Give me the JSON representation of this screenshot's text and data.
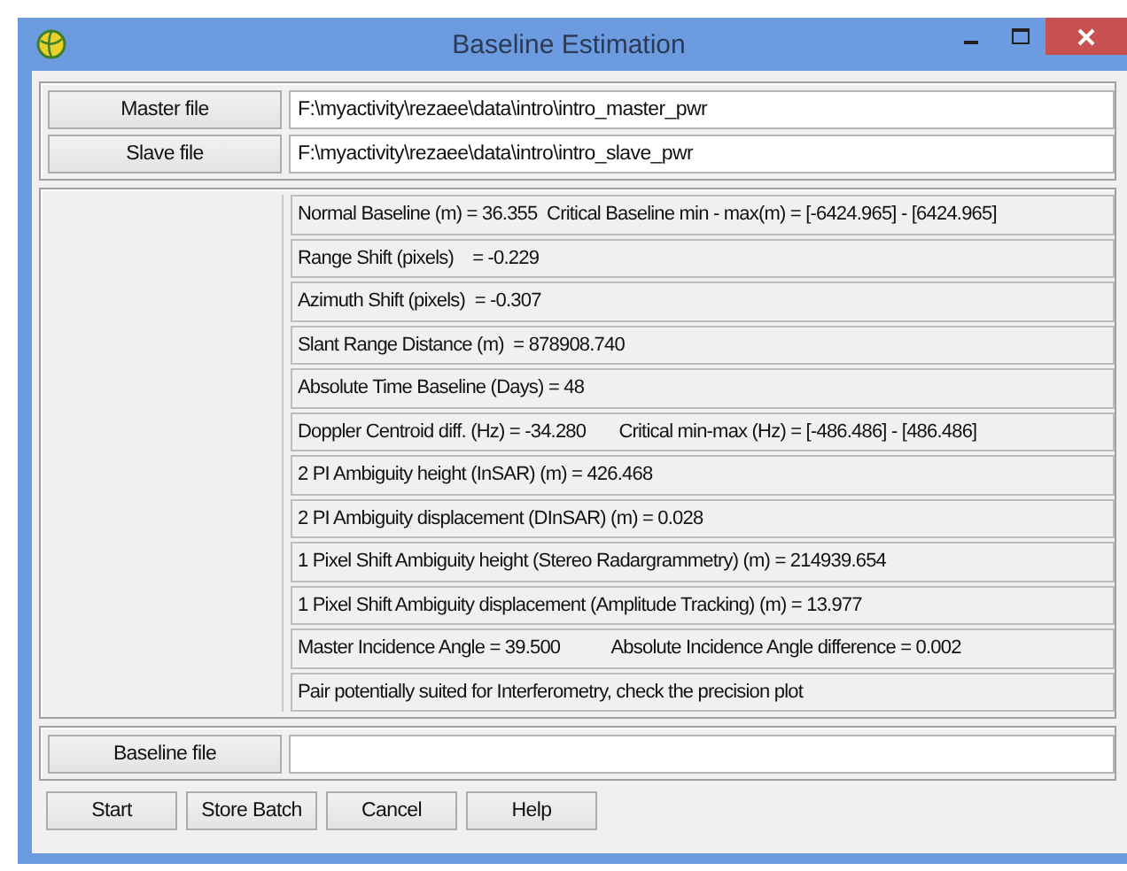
{
  "window": {
    "title": "Baseline Estimation"
  },
  "files": [
    {
      "button": "Master file",
      "value": "F:\\myactivity\\rezaee\\data\\intro\\intro_master_pwr"
    },
    {
      "button": "Slave file",
      "value": "F:\\myactivity\\rezaee\\data\\intro\\intro_slave_pwr"
    }
  ],
  "results": [
    "Normal Baseline (m) = 36.355  Critical Baseline min - max(m) = [-6424.965] - [6424.965]",
    "Range Shift (pixels)    = -0.229",
    "Azimuth Shift (pixels)  = -0.307",
    "Slant Range Distance (m)  = 878908.740",
    "Absolute Time Baseline (Days) = 48",
    "Doppler Centroid diff. (Hz) = -34.280       Critical min-max (Hz) = [-486.486] - [486.486]",
    "2 PI Ambiguity height (InSAR) (m) = 426.468",
    "2 PI Ambiguity displacement (DInSAR) (m) = 0.028",
    "1 Pixel Shift Ambiguity height (Stereo Radargrammetry) (m) = 214939.654",
    "1 Pixel Shift Ambiguity displacement (Amplitude Tracking) (m) = 13.977",
    "Master Incidence Angle = 39.500           Absolute Incidence Angle difference = 0.002",
    "Pair potentially suited for Interferometry, check the precision plot"
  ],
  "baseline_file": {
    "button": "Baseline file"
  },
  "buttons": [
    "Start",
    "Store Batch",
    "Cancel",
    "Help"
  ]
}
